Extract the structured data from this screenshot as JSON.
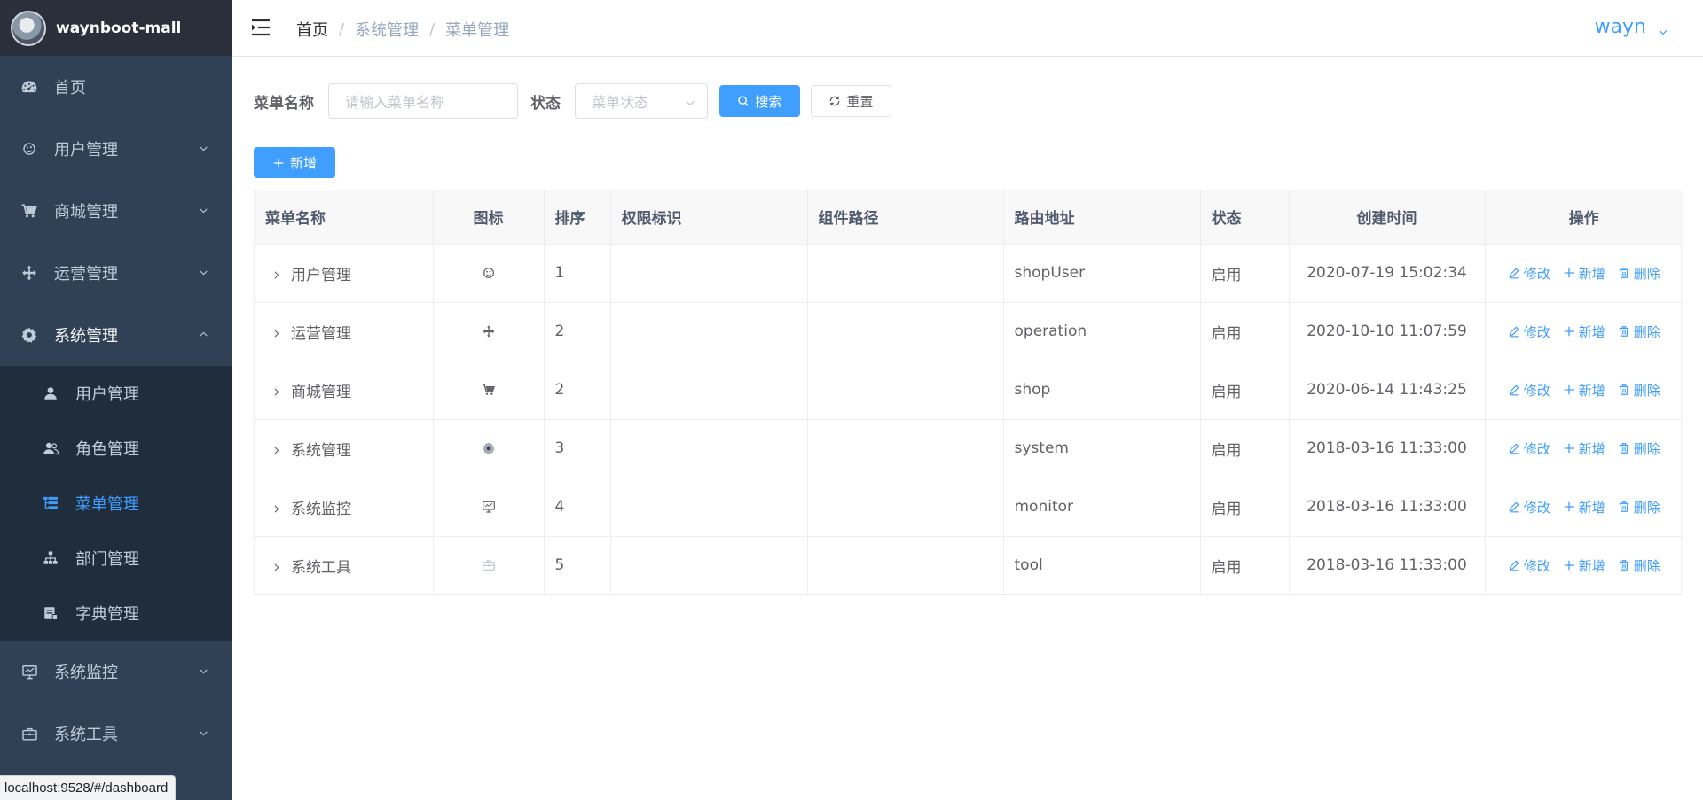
{
  "app": {
    "title": "waynboot-mall"
  },
  "sidebar": {
    "items": [
      {
        "label": "首页",
        "icon": "dashboard-icon",
        "has_children": false
      },
      {
        "label": "用户管理",
        "icon": "peoples-icon",
        "has_children": true
      },
      {
        "label": "商城管理",
        "icon": "cart-icon",
        "has_children": true
      },
      {
        "label": "运营管理",
        "icon": "move-icon",
        "has_children": true
      },
      {
        "label": "系统管理",
        "icon": "gear-icon",
        "has_children": true,
        "expanded": true
      }
    ],
    "sub_items": [
      {
        "label": "用户管理",
        "icon": "user-icon"
      },
      {
        "label": "角色管理",
        "icon": "role-icon"
      },
      {
        "label": "菜单管理",
        "icon": "tree-table-icon",
        "active": true
      },
      {
        "label": "部门管理",
        "icon": "tree-icon"
      },
      {
        "label": "字典管理",
        "icon": "dict-icon"
      }
    ],
    "bottom_items": [
      {
        "label": "系统监控",
        "icon": "monitor-icon"
      },
      {
        "label": "系统工具",
        "icon": "toolbox-icon"
      }
    ]
  },
  "header": {
    "breadcrumb": [
      "首页",
      "系统管理",
      "菜单管理"
    ],
    "separator": "/",
    "user": "wayn"
  },
  "search": {
    "name_label": "菜单名称",
    "name_placeholder": "请输入菜单名称",
    "status_label": "状态",
    "status_placeholder": "菜单状态",
    "search_button": "搜索",
    "reset_button": "重置"
  },
  "toolbar": {
    "add_button": "新增"
  },
  "table": {
    "columns": [
      "菜单名称",
      "图标",
      "排序",
      "权限标识",
      "组件路径",
      "路由地址",
      "状态",
      "创建时间",
      "操作"
    ],
    "rows": [
      {
        "name": "用户管理",
        "icon": "peoples-icon",
        "order": "1",
        "perms": "",
        "component": "",
        "path": "shopUser",
        "status": "启用",
        "created": "2020-07-19 15:02:34"
      },
      {
        "name": "运营管理",
        "icon": "move-icon",
        "order": "2",
        "perms": "",
        "component": "",
        "path": "operation",
        "status": "启用",
        "created": "2020-10-10 11:07:59"
      },
      {
        "name": "商城管理",
        "icon": "cart-icon",
        "order": "2",
        "perms": "",
        "component": "",
        "path": "shop",
        "status": "启用",
        "created": "2020-06-14 11:43:25"
      },
      {
        "name": "系统管理",
        "icon": "gear-icon",
        "order": "3",
        "perms": "",
        "component": "",
        "path": "system",
        "status": "启用",
        "created": "2018-03-16 11:33:00"
      },
      {
        "name": "系统监控",
        "icon": "monitor-icon",
        "order": "4",
        "perms": "",
        "component": "",
        "path": "monitor",
        "status": "启用",
        "created": "2018-03-16 11:33:00"
      },
      {
        "name": "系统工具",
        "icon": "toolbox-icon",
        "order": "5",
        "perms": "",
        "component": "",
        "path": "tool",
        "status": "启用",
        "created": "2018-03-16 11:33:00"
      }
    ],
    "actions": {
      "edit": "修改",
      "add": "新增",
      "delete": "删除"
    }
  },
  "statusbar": {
    "url": "localhost:9528/#/dashboard"
  },
  "colors": {
    "primary": "#409eff",
    "sidebar_bg": "#304156",
    "submenu_bg": "#1f2d3d",
    "logo_bg": "#2b2f3a"
  }
}
